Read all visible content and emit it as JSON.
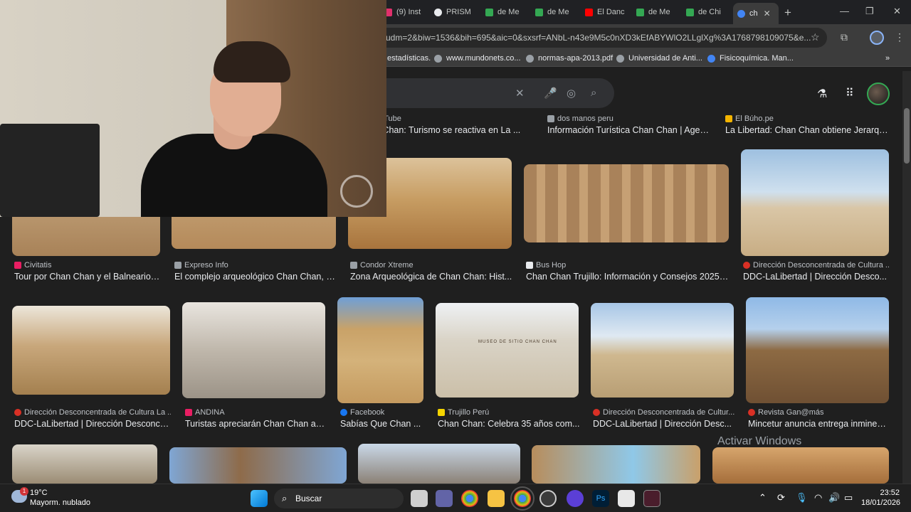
{
  "browser": {
    "tabs": [
      {
        "label": "(9) Inst",
        "color": "#e1306c"
      },
      {
        "label": "PRISM",
        "color": "#e8eaed"
      },
      {
        "label": "de Me",
        "color": "#34a853"
      },
      {
        "label": "de Me",
        "color": "#34a853"
      },
      {
        "label": "El Danc",
        "color": "#ff0000"
      },
      {
        "label": "de Me",
        "color": "#34a853"
      },
      {
        "label": "de Chi",
        "color": "#34a853"
      },
      {
        "label": "ch",
        "color": "#4285f4"
      }
    ],
    "new_tab": "+",
    "url": "udm=2&biw=1536&bih=695&aic=0&sxsrf=ANbL-n43e9M5c0nXD3kEfABYWlO2LLglXg%3A1768798109075&e...",
    "bookmarks": [
      "estadísticas.",
      "www.mundonets.co...",
      "normas-apa-2013.pdf",
      "Universidad de Anti...",
      "Fisicoquímica. Man..."
    ]
  },
  "results": {
    "row1": [
      {
        "source": "ouTube",
        "title": "n Chan: Turismo se reactiva en La ..."
      },
      {
        "source": "dos manos peru",
        "title": "Información Turística Chan Chan | Agen..."
      },
      {
        "source": "El Búho.pe",
        "title": "La Libertad: Chan Chan obtiene Jerarqu..."
      }
    ],
    "row2": [
      {
        "source": "Civitatis",
        "title": "Tour por Chan Chan y el Balneario ..."
      },
      {
        "source": "Expreso Info",
        "title": "El complejo arqueológico Chan Chan, g..."
      },
      {
        "source": "Condor Xtreme",
        "title": "Zona Arqueológica de Chan Chan: Hist..."
      },
      {
        "source": "Bus Hop",
        "title": "Chan Chan Trujillo: Información y Consejos 2025 -..."
      },
      {
        "source": "Dirección Desconcentrada de Cultura ...",
        "title": "DDC-LaLibertad | Dirección Desco..."
      }
    ],
    "row3": [
      {
        "source": "Dirección Desconcentrada de Cultura La ...",
        "title": "DDC-LaLibertad | Dirección Desconce..."
      },
      {
        "source": "ANDINA",
        "title": "Turistas apreciarán Chan Chan a ..."
      },
      {
        "source": "Facebook",
        "title": "Sabías Que Chan ..."
      },
      {
        "source": "Trujillo Perú",
        "title": "Chan Chan: Celebra 35 años com..."
      },
      {
        "source": "Dirección Desconcentrada de Cultur...",
        "title": "DDC-LaLibertad | Dirección Desc..."
      },
      {
        "source": "Revista Gan@más",
        "title": "Mincetur anuncia entrega inminen..."
      }
    ],
    "museum_sign": "MUSEO DE SITIO CHAN CHAN"
  },
  "watermark": "Activar Windows",
  "taskbar": {
    "temperature": "19°C",
    "weather": "Mayorm. nublado",
    "weather_badge": "1",
    "search_placeholder": "Buscar",
    "time": "23:52",
    "date": "18/01/2026"
  }
}
